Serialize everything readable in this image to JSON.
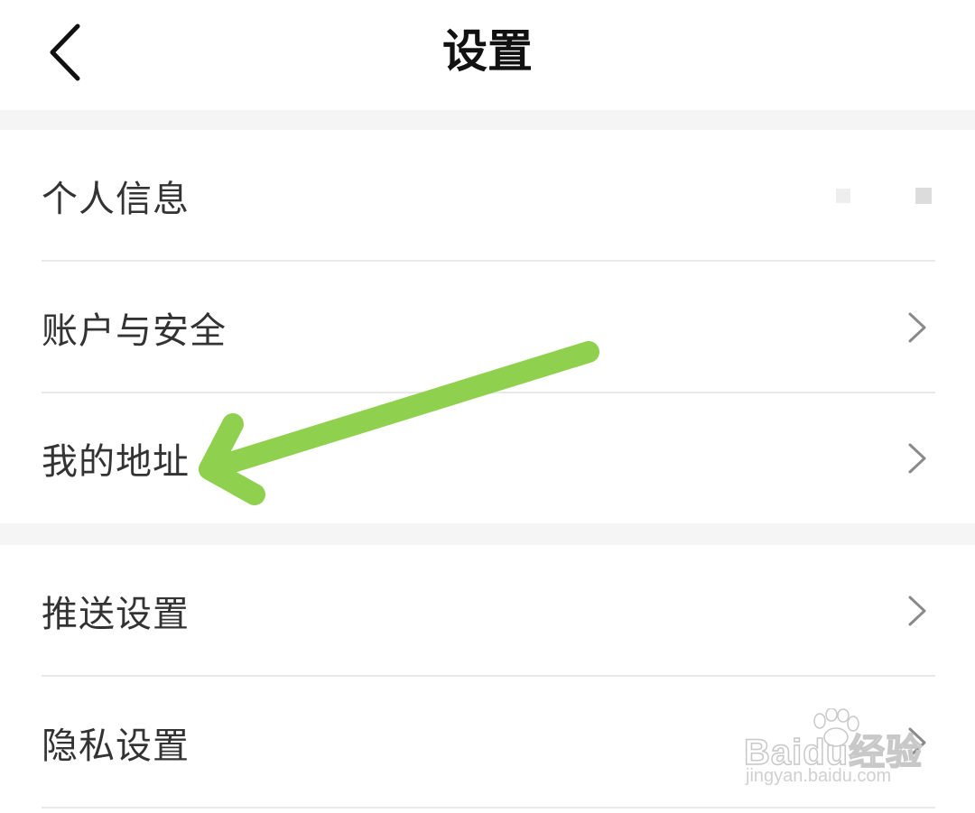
{
  "header": {
    "title": "设置",
    "back_icon": "chevron-left-icon"
  },
  "groups": [
    {
      "items": [
        {
          "label": "个人信息",
          "trailing": "placeholder"
        },
        {
          "label": "账户与安全",
          "trailing": "chevron-right-icon"
        },
        {
          "label": "我的地址",
          "trailing": "chevron-right-icon"
        }
      ]
    },
    {
      "items": [
        {
          "label": "推送设置",
          "trailing": "chevron-right-icon"
        },
        {
          "label": "隐私设置",
          "trailing": "chevron-right-icon"
        }
      ]
    }
  ],
  "annotation": {
    "icon": "arrow-annotation-icon",
    "color": "#8fd14f",
    "points_to": "我的地址"
  },
  "watermark": {
    "brand": "Baidu经验",
    "url": "jingyan.baidu.com"
  },
  "colors": {
    "background": "#f5f5f5",
    "surface": "#ffffff",
    "divider": "#e9e9e9",
    "text": "#333333",
    "chevron": "#8a8a8a"
  }
}
